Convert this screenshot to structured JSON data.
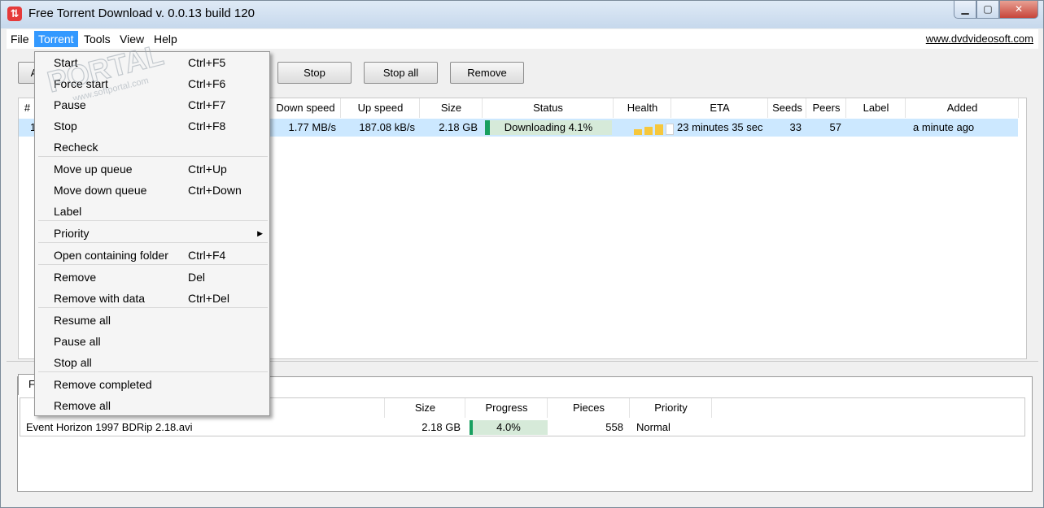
{
  "window": {
    "title": "Free Torrent Download v. 0.0.13 build 120",
    "min_glyph": "▁",
    "max_glyph": "▢",
    "close_glyph": "✕"
  },
  "menubar": {
    "items": [
      "File",
      "Torrent",
      "Tools",
      "View",
      "Help"
    ],
    "active": "Torrent",
    "link": "www.dvdvideosoft.com"
  },
  "toolbar": {
    "add_peek": "A",
    "stop": "Stop",
    "stop_all": "Stop all",
    "remove": "Remove"
  },
  "torrent_list": {
    "columns": [
      "#",
      "Down speed",
      "Up speed",
      "Size",
      "Status",
      "Health",
      "ETA",
      "Seeds",
      "Peers",
      "Label",
      "Added"
    ],
    "row": {
      "index": "1",
      "down_speed": "1.77 MB/s",
      "up_speed": "187.08 kB/s",
      "size": "2.18 GB",
      "status": "Downloading 4.1%",
      "progress_percent": 4.1,
      "health_bars": [
        1,
        2,
        3,
        0
      ],
      "eta": "23 minutes 35 sec",
      "seeds": "33",
      "peers": "57",
      "label": "",
      "added": "a minute ago"
    }
  },
  "bottom": {
    "tab_peek": "F",
    "columns": [
      "Size",
      "Progress",
      "Pieces",
      "Priority"
    ],
    "file": {
      "name": "Event Horizon 1997 BDRip 2.18.avi",
      "size": "2.18 GB",
      "progress": "4.0%",
      "progress_percent": 4.0,
      "pieces": "558",
      "priority": "Normal"
    }
  },
  "dropdown": {
    "items": [
      {
        "label": "Start",
        "shortcut": "Ctrl+F5"
      },
      {
        "label": "Force start",
        "shortcut": "Ctrl+F6"
      },
      {
        "label": "Pause",
        "shortcut": "Ctrl+F7"
      },
      {
        "label": "Stop",
        "shortcut": "Ctrl+F8"
      },
      {
        "label": "Recheck",
        "shortcut": ""
      },
      {
        "label": "Move up queue",
        "shortcut": "Ctrl+Up"
      },
      {
        "label": "Move down queue",
        "shortcut": "Ctrl+Down"
      },
      {
        "label": "Label",
        "shortcut": ""
      },
      {
        "label": "Priority",
        "shortcut": ""
      },
      {
        "label": "Open containing folder",
        "shortcut": "Ctrl+F4"
      },
      {
        "label": "Remove",
        "shortcut": "Del"
      },
      {
        "label": "Remove with data",
        "shortcut": "Ctrl+Del"
      },
      {
        "label": "Resume all",
        "shortcut": ""
      },
      {
        "label": "Pause all",
        "shortcut": ""
      },
      {
        "label": "Stop all",
        "shortcut": ""
      },
      {
        "label": "Remove completed",
        "shortcut": ""
      },
      {
        "label": "Remove all",
        "shortcut": ""
      }
    ],
    "submenu_arrow": "▶"
  },
  "watermark": {
    "text": "PORTAL",
    "subtext": "www.softportal.com"
  }
}
